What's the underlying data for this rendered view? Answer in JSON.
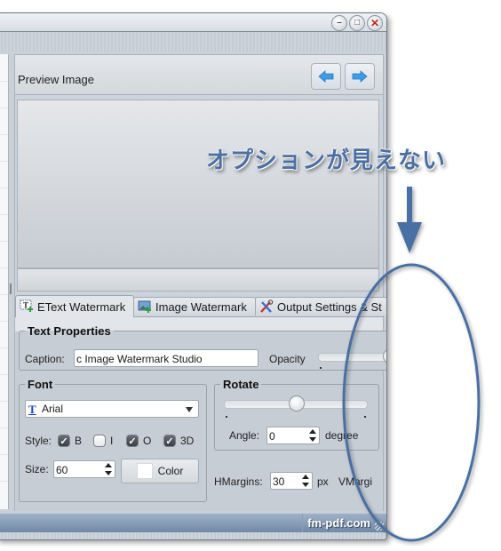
{
  "window": {
    "controls": {
      "minimize": "–",
      "maximize": "□",
      "close": "✕"
    }
  },
  "preview": {
    "title": "Preview Image",
    "prev_icon": "arrow-left-icon",
    "next_icon": "arrow-right-icon"
  },
  "tabs": [
    {
      "label": "EText Watermark",
      "icon": "text-watermark-icon",
      "active": true
    },
    {
      "label": "Image Watermark",
      "icon": "image-watermark-icon",
      "active": false
    },
    {
      "label": "Output Settings & St",
      "icon": "tools-icon",
      "active": false
    }
  ],
  "text_properties": {
    "legend": "Text Properties",
    "caption_label": "Caption:",
    "caption_value": "c Image Watermark Studio",
    "opacity_label": "Opacity",
    "opacity_value": 1.0
  },
  "font": {
    "legend": "Font",
    "family": "Arial",
    "style_label": "Style:",
    "styles": [
      {
        "label": "B",
        "checked": true
      },
      {
        "label": "I",
        "checked": false
      },
      {
        "label": "O",
        "checked": true
      },
      {
        "label": "3D",
        "checked": true
      }
    ],
    "size_label": "Size:",
    "size_value": "60",
    "color_button": "Color",
    "color_value": "#ffffff"
  },
  "rotate": {
    "legend": "Rotate",
    "angle_label": "Angle:",
    "angle_value": "0",
    "angle_unit": "degree",
    "slider_fraction": 0.5
  },
  "margins": {
    "h_label": "HMargins:",
    "h_value": "30",
    "h_unit": "px",
    "v_label": "VMargi"
  },
  "statusbar": {
    "text": "fm-pdf.com"
  },
  "annotation": {
    "text": "オプションが見えない",
    "color": "#4a6fa3"
  }
}
